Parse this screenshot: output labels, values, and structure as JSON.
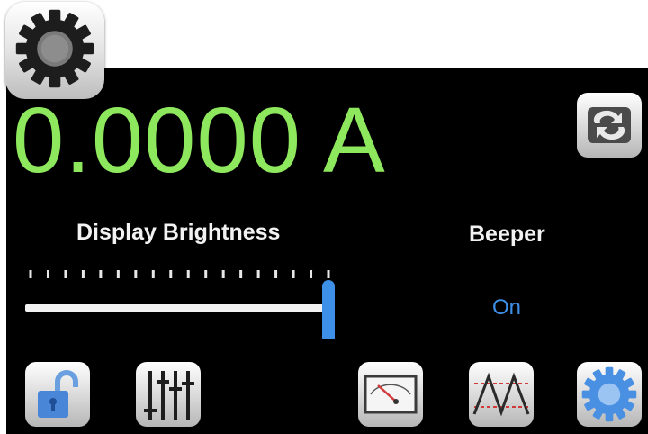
{
  "settings_icon": {
    "icon": "gear-icon"
  },
  "readout": {
    "value": "0.0000 A",
    "color": "#8ee85e"
  },
  "top_button": {
    "icon": "swap-arrows-icon"
  },
  "display_brightness": {
    "label": "Display Brightness",
    "level_percent": 100,
    "tick_count": 18,
    "accent": "#3d8fe8"
  },
  "beeper": {
    "label": "Beeper",
    "value": "On"
  },
  "toolbar": {
    "buttons": [
      {
        "icon": "unlock-icon"
      },
      {
        "icon": "sliders-icon"
      },
      {
        "icon": "analog-meter-icon"
      },
      {
        "icon": "waveform-icon"
      },
      {
        "icon": "gear-icon"
      }
    ]
  }
}
